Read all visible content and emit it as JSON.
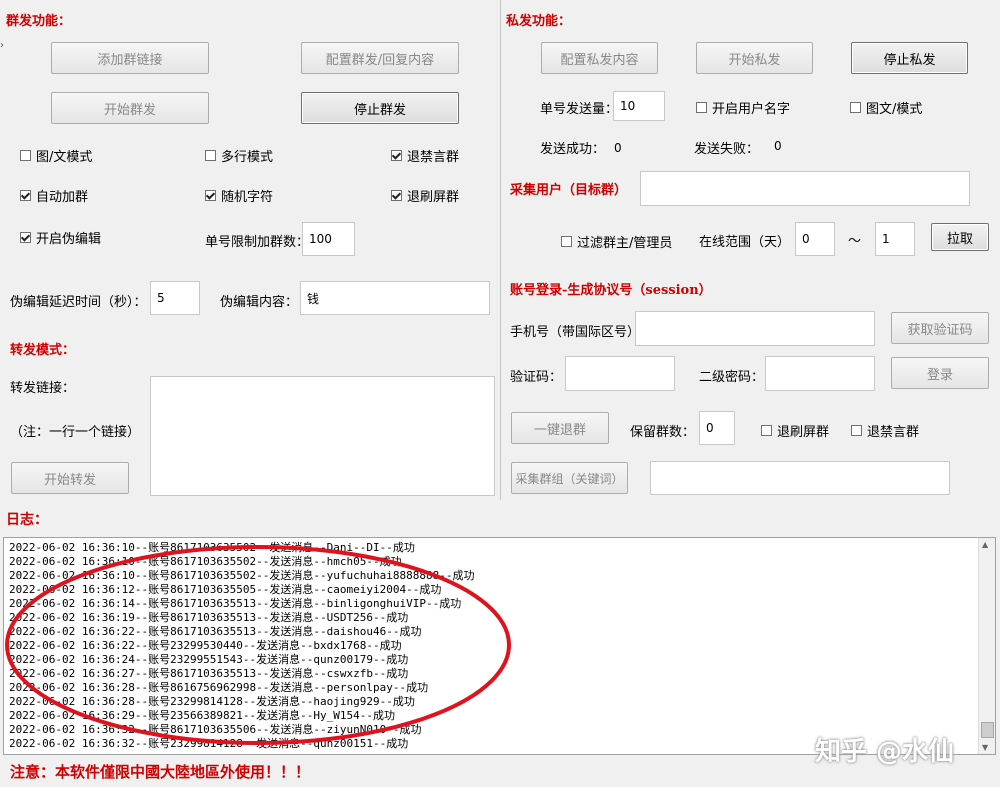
{
  "mass": {
    "title": "群发功能：",
    "add_link": "添加群链接",
    "config_reply": "配置群发/回复内容",
    "start": "开始群发",
    "stop": "停止群发",
    "cb_image_text": "图/文模式",
    "cb_multiline": "多行模式",
    "cb_quit_mute": "退禁言群",
    "cb_auto_join": "自动加群",
    "cb_random_char": "随机字符",
    "cb_quit_spam": "退刷屏群",
    "cb_fake_edit": "开启伪编辑",
    "limit_label": "单号限制加群数：",
    "limit_value": "100",
    "fake_delay_label": "伪编辑延迟时间（秒）：",
    "fake_delay_value": "5",
    "fake_content_label": "伪编辑内容：",
    "fake_content_value": "钱"
  },
  "forward": {
    "title": "转发模式：",
    "link_label": "转发链接：",
    "note": "（注：一行一个链接）",
    "start": "开始转发"
  },
  "private": {
    "title": "私发功能：",
    "config": "配置私发内容",
    "start": "开始私发",
    "stop": "停止私发",
    "send_count_label": "单号发送量：",
    "send_count_value": "10",
    "cb_username": "开启用户名字",
    "cb_image_text": "图文/模式",
    "success_label": "发送成功：",
    "success_value": "0",
    "fail_label": "发送失败：",
    "fail_value": "0"
  },
  "collect": {
    "title": "采集用户（目标群）",
    "cb_filter": "过滤群主/管理员",
    "online_label": "在线范围（天）",
    "from_value": "0",
    "tilde": "～",
    "to_value": "1",
    "pull": "拉取"
  },
  "login": {
    "title": "账号登录-生成协议号（session）",
    "phone_label": "手机号（带国际区号）",
    "get_code": "获取验证码",
    "code_label": "验证码：",
    "pwd2_label": "二级密码：",
    "login": "登录",
    "quit_all": "一键退群",
    "keep_label": "保留群数：",
    "keep_value": "0",
    "cb_quit_spam": "退刷屏群",
    "cb_quit_mute": "退禁言群",
    "collect_groups": "采集群组（关键词）"
  },
  "log": {
    "title": "日志：",
    "lines": [
      "2022-06-02 16:36:10--账号8617103635502--发送消息--Dani--DI--成功",
      "2022-06-02 16:36:10--账号8617103635502--发送消息--hmch05--成功",
      "2022-06-02 16:36:10--账号8617103635502--发送消息--yufuchuhai8888888--成功",
      "2022-06-02 16:36:12--账号8617103635505--发送消息--caomeiyi2004--成功",
      "2022-06-02 16:36:14--账号8617103635513--发送消息--binligonghuiVIP--成功",
      "2022-06-02 16:36:19--账号8617103635513--发送消息--USDT256--成功",
      "2022-06-02 16:36:22--账号8617103635513--发送消息--daishou46--成功",
      "2022-06-02 16:36:22--账号23299530440--发送消息--bxdx1768--成功",
      "2022-06-02 16:36:24--账号23299551543--发送消息--qunz00179--成功",
      "2022-06-02 16:36:27--账号8617103635513--发送消息--cswxzfb--成功",
      "2022-06-02 16:36:28--账号8616756962998--发送消息--personlpay--成功",
      "2022-06-02 16:36:28--账号23299814128--发送消息--haojing929--成功",
      "2022-06-02 16:36:29--账号23566389821--发送消息--Hy_W154--成功",
      "2022-06-02 16:36:32--账号8617103635506--发送消息--ziyunN010--成功",
      "2022-06-02 16:36:32--账号23299814128--发送消息--qunz00151--成功"
    ]
  },
  "footer": {
    "notice": "注意：本软件僅限中國大陸地區外使用！！！",
    "watermark": "知乎 @水仙"
  },
  "colors": {
    "section_red": "#d00000",
    "annotation_red": "#e0121e"
  }
}
